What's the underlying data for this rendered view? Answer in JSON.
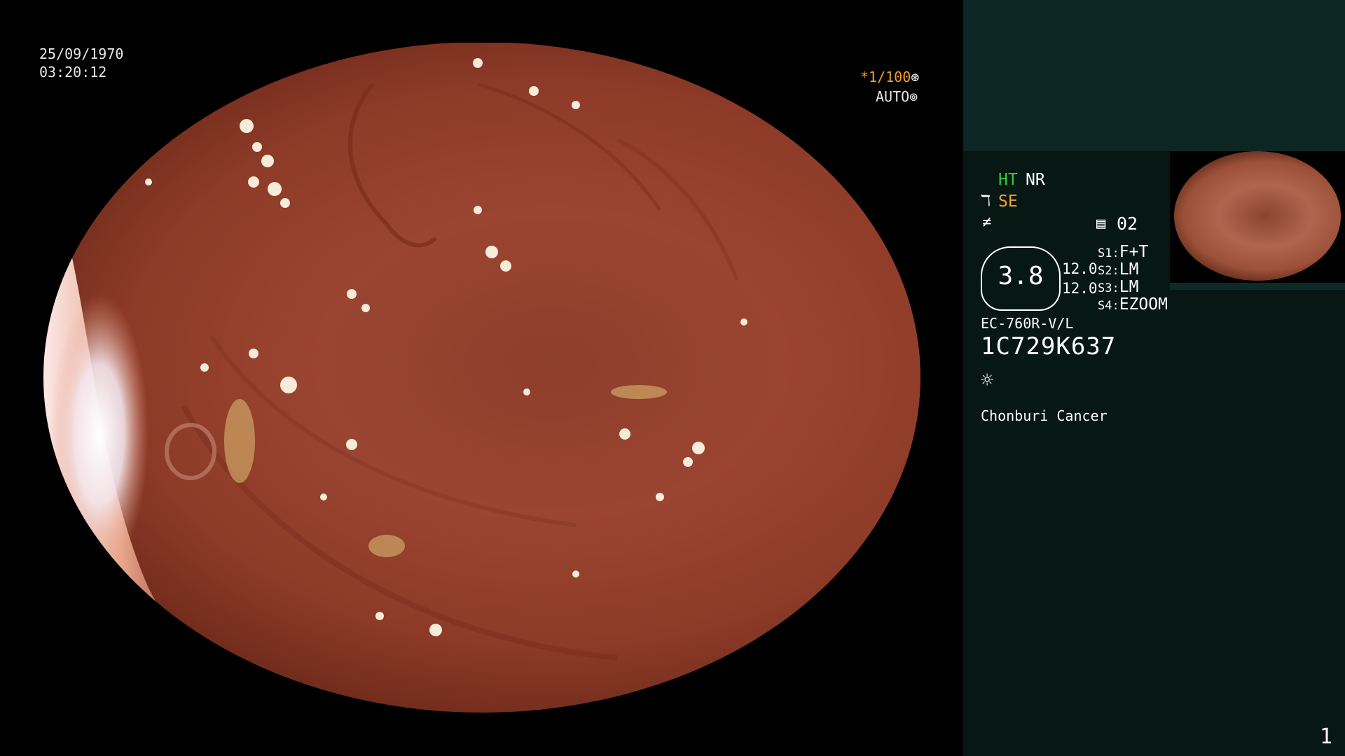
{
  "overlay": {
    "date": "25/09/1970",
    "time": "03:20:12",
    "shutter": "*1/100",
    "iris_mode": "AUTO"
  },
  "panel": {
    "ht": "HT",
    "nr": "NR",
    "se": "SE",
    "memory_index": "02",
    "gauge_value": "3.8",
    "level_top": "12.0",
    "level_bottom": "12.0",
    "switches": [
      {
        "key": "S1:",
        "value": "F+T"
      },
      {
        "key": "S2:",
        "value": "LM"
      },
      {
        "key": "S3:",
        "value": "LM"
      },
      {
        "key": "S4:",
        "value": "EZOOM"
      }
    ],
    "scope_model": "EC-760R-V/L",
    "scope_serial": "1C729K637",
    "institution": "Chonburi Cancer",
    "page_number": "1"
  },
  "icons": {
    "shutter": "aperture-icon",
    "iris": "iris-icon",
    "enhance": "enhance-icon",
    "structure": "structure-icon",
    "memory": "memory-icon",
    "light": "light-sun-icon"
  },
  "colors": {
    "panel_bg": "#061714",
    "panel_top_bg": "#0c2624",
    "accent_green": "#29d13c",
    "accent_orange": "#f5a623"
  }
}
